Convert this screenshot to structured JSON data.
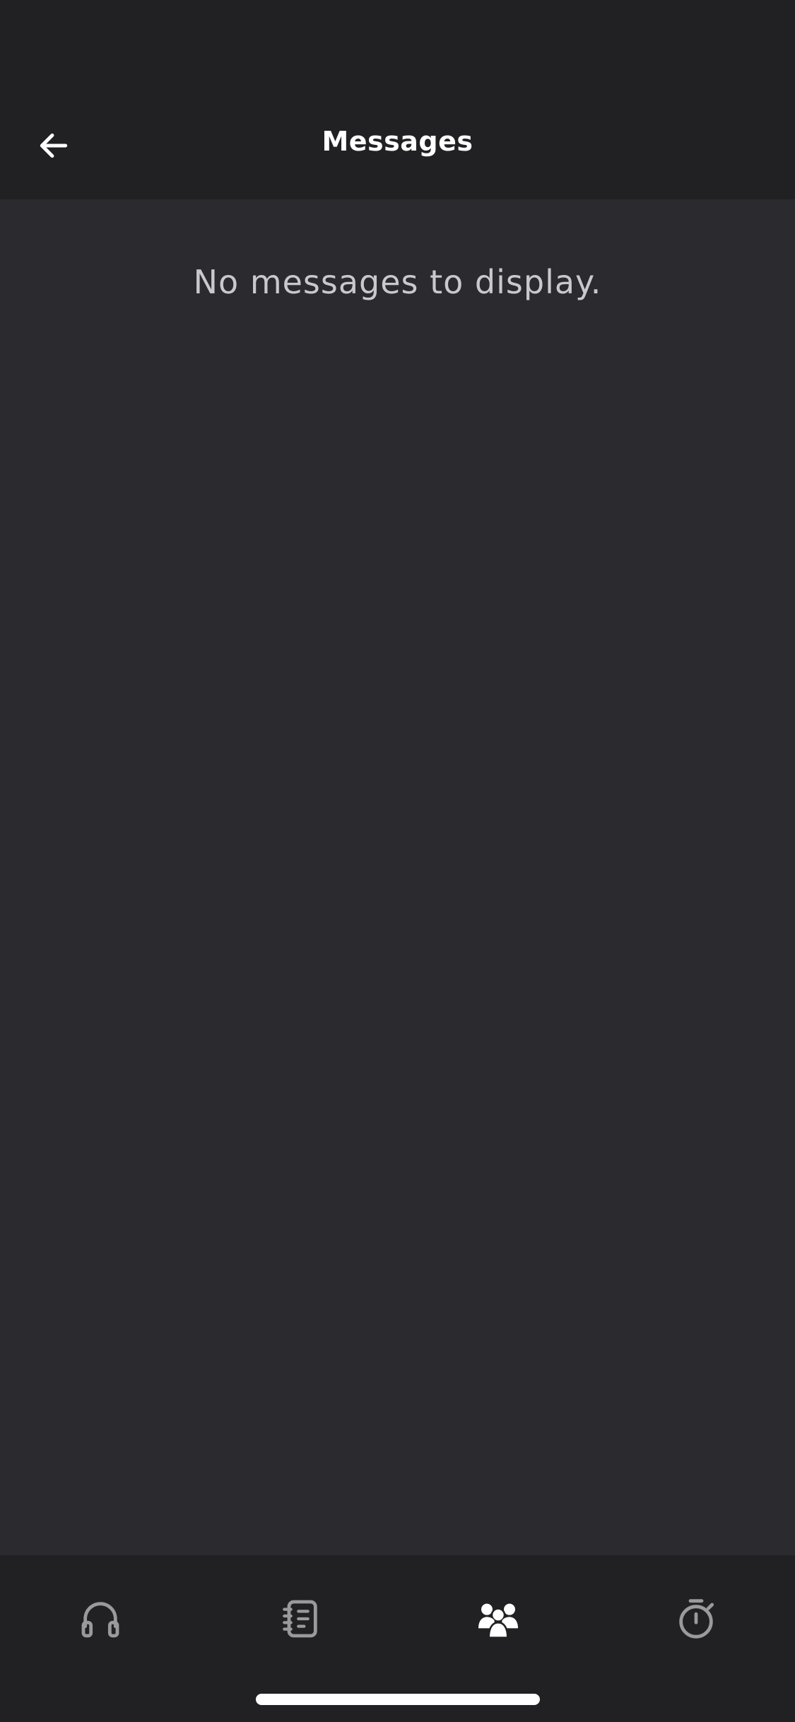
{
  "header": {
    "title": "Messages",
    "back_icon": "arrow-left-icon"
  },
  "main": {
    "empty_message": "No messages to display."
  },
  "tabbar": {
    "tabs": [
      {
        "icon": "headphones-icon",
        "active": false
      },
      {
        "icon": "notebook-icon",
        "active": false
      },
      {
        "icon": "community-icon",
        "active": true
      },
      {
        "icon": "stopwatch-icon",
        "active": false
      }
    ]
  },
  "colors": {
    "header_bg": "#212123",
    "content_bg": "#2b2a2f",
    "title_text": "#ffffff",
    "empty_text": "#c9c9cc",
    "inactive_icon": "#9a9a9e",
    "active_icon": "#ffffff"
  }
}
